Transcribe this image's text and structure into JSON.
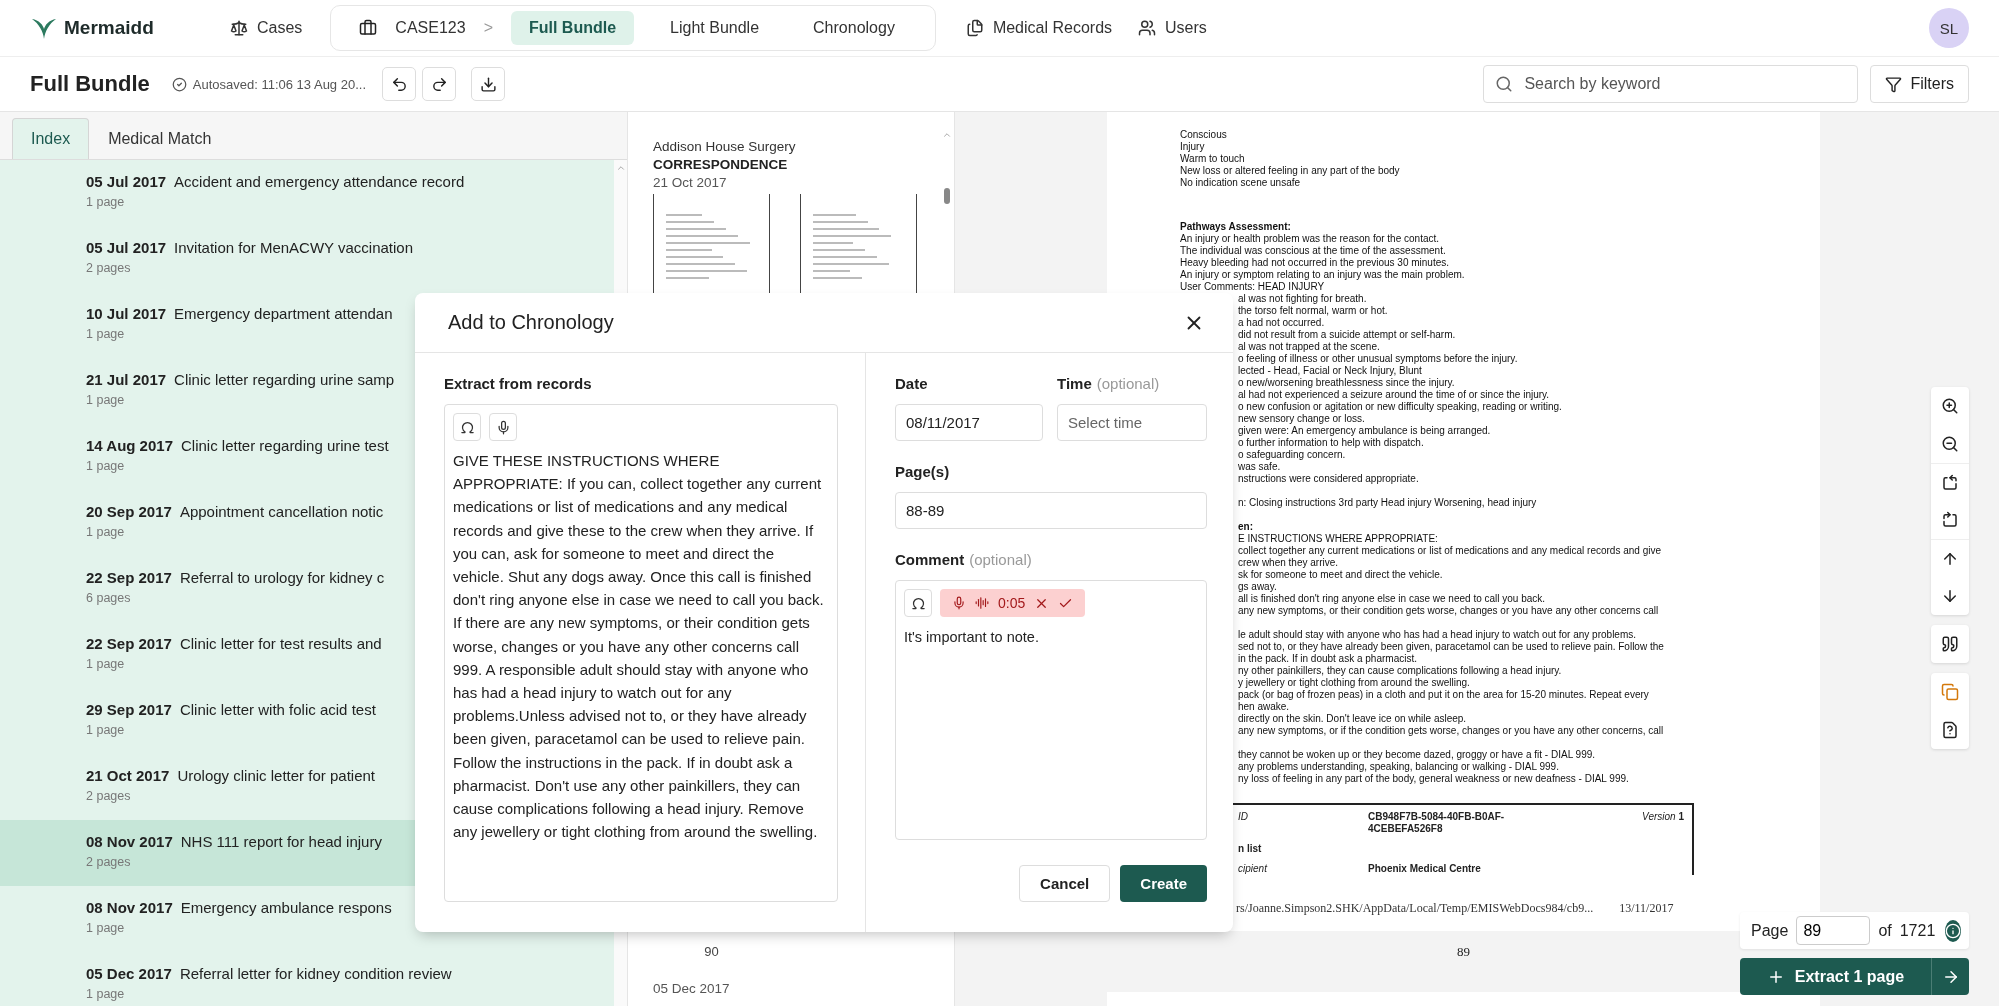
{
  "top_nav": {
    "logo": "Mermaidd",
    "cases": "Cases",
    "case": "CASE123",
    "separator": ">",
    "tabs": [
      {
        "label": "Full Bundle",
        "selected": true
      },
      {
        "label": "Light Bundle",
        "selected": false
      },
      {
        "label": "Chronology",
        "selected": false
      }
    ],
    "links": [
      "Medical Records",
      "Users"
    ],
    "avatar": "SL"
  },
  "toolbar": {
    "title": "Full Bundle",
    "autosaved": "Autosaved: 11:06 13 Aug 20...",
    "search": {
      "placeholder": "Search by keyword"
    },
    "filters": "Filters"
  },
  "index_panel": {
    "tabs": [
      {
        "label": "Index",
        "selected": true
      },
      {
        "label": "Medical Match",
        "selected": false
      }
    ],
    "entries": [
      {
        "date": "05 Jul 2017",
        "title": "Accident and emergency attendance record",
        "pages": "1 page",
        "selected": false
      },
      {
        "date": "05 Jul 2017",
        "title": "Invitation for MenACWY vaccination",
        "pages": "2 pages",
        "selected": false
      },
      {
        "date": "10 Jul 2017",
        "title": "Emergency department attendan",
        "pages": "1 page",
        "selected": false
      },
      {
        "date": "21 Jul 2017",
        "title": "Clinic letter regarding urine samp",
        "pages": "1 page",
        "selected": false
      },
      {
        "date": "14 Aug 2017",
        "title": "Clinic letter regarding urine test",
        "pages": "1 page",
        "selected": false
      },
      {
        "date": "20 Sep 2017",
        "title": "Appointment cancellation notic",
        "pages": "1 page",
        "selected": false
      },
      {
        "date": "22 Sep 2017",
        "title": "Referral to urology for kidney c",
        "pages": "6 pages",
        "selected": false
      },
      {
        "date": "22 Sep 2017",
        "title": "Clinic letter for test results and",
        "pages": "1 page",
        "selected": false
      },
      {
        "date": "29 Sep 2017",
        "title": "Clinic letter with folic acid test",
        "pages": "1 page",
        "selected": false
      },
      {
        "date": "21 Oct 2017",
        "title": "Urology clinic letter for patient",
        "pages": "2 pages",
        "selected": false
      },
      {
        "date": "08 Nov 2017",
        "title": "NHS 111 report for head injury",
        "pages": "2 pages",
        "selected": true
      },
      {
        "date": "08 Nov 2017",
        "title": "Emergency ambulance respons",
        "pages": "1 page",
        "selected": false
      },
      {
        "date": "05 Dec 2017",
        "title": "Referral letter for kidney condition review",
        "pages": "1 page",
        "selected": false
      }
    ]
  },
  "thumbnails": {
    "source": "Addison House Surgery",
    "category": "CORRESPONDENCE",
    "date": "21 Oct 2017",
    "page_number": "90",
    "next_date": "05 Dec 2017"
  },
  "document": {
    "blocks": [
      {
        "lines": [
          {
            "text": "Conscious",
            "kind": "text",
            "cut": false
          },
          {
            "text": "Injury",
            "kind": "text",
            "cut": false
          },
          {
            "text": "Warm to touch",
            "kind": "text",
            "cut": false
          },
          {
            "text": "New loss or altered feeling in any part of the body",
            "kind": "text",
            "cut": false
          },
          {
            "text": "No indication scene unsafe",
            "kind": "text",
            "cut": false
          }
        ]
      },
      {
        "lines": [
          {
            "text": "Pathways Assessment:",
            "kind": "heading",
            "cut": false
          },
          {
            "text": "An injury or health problem was the reason for the contact.",
            "kind": "text",
            "cut": false
          },
          {
            "text": "The individual was conscious at the time of the assessment.",
            "kind": "text",
            "cut": false
          },
          {
            "text": "Heavy bleeding had not occurred in the previous 30 minutes.",
            "kind": "text",
            "cut": false
          },
          {
            "text": "An injury or symptom relating to an injury was the main problem.",
            "kind": "text",
            "cut": false
          },
          {
            "text": "User Comments: HEAD INJURY",
            "kind": "text",
            "cut": false
          },
          {
            "text": "al was not fighting for breath.",
            "kind": "text",
            "cut": true
          },
          {
            "text": "the torso felt normal, warm or hot.",
            "kind": "text",
            "cut": true
          },
          {
            "text": "a had not occurred.",
            "kind": "text",
            "cut": true
          },
          {
            "text": "did not result from a suicide attempt or self-harm.",
            "kind": "text",
            "cut": true
          },
          {
            "text": "al was not trapped at the scene.",
            "kind": "text",
            "cut": true
          },
          {
            "text": "o feeling of illness or other unusual symptoms before the injury.",
            "kind": "text",
            "cut": true
          },
          {
            "text": "lected - Head, Facial or Neck Injury, Blunt",
            "kind": "text",
            "cut": true
          },
          {
            "text": "o new/worsening breathlessness since the injury.",
            "kind": "text",
            "cut": true
          },
          {
            "text": "al had not experienced a seizure around the time of or since the injury.",
            "kind": "text",
            "cut": true
          },
          {
            "text": "o new confusion or agitation or new difficulty speaking, reading or writing.",
            "kind": "text",
            "cut": true
          },
          {
            "text": "new sensory change or loss.",
            "kind": "text",
            "cut": true
          },
          {
            "text": "given were: An emergency ambulance is being arranged.",
            "kind": "text",
            "cut": true
          },
          {
            "text": "o further information to help with dispatch.",
            "kind": "text",
            "cut": true
          },
          {
            "text": "o safeguarding concern.",
            "kind": "text",
            "cut": true
          },
          {
            "text": "was safe.",
            "kind": "text",
            "cut": true
          },
          {
            "text": "nstructions were considered appropriate.",
            "kind": "text",
            "cut": true
          }
        ]
      },
      {
        "lines": [
          {
            "text": "n: Closing instructions 3rd party Head injury Worsening, head injury",
            "kind": "text",
            "cut": true
          }
        ]
      },
      {
        "lines": [
          {
            "text": "en:",
            "kind": "heading",
            "cut": true
          },
          {
            "text": "E INSTRUCTIONS WHERE APPROPRIATE:",
            "kind": "text",
            "cut": true
          },
          {
            "text": "collect together any current medications or list of medications and any medical records and give",
            "kind": "text",
            "cut": true
          },
          {
            "text": "crew when they arrive.",
            "kind": "text",
            "cut": true
          },
          {
            "text": "sk for someone to meet and direct the vehicle.",
            "kind": "text",
            "cut": true
          },
          {
            "text": "gs away.",
            "kind": "text",
            "cut": true
          },
          {
            "text": "all is finished don't ring anyone else in case we need to call you back.",
            "kind": "text",
            "cut": true
          },
          {
            "text": "any new symptoms, or their condition gets worse, changes or you have any other concerns call",
            "kind": "text",
            "cut": true
          }
        ]
      },
      {
        "lines": [
          {
            "text": "le adult should stay with anyone who has had a head injury to watch out for any problems.",
            "kind": "text",
            "cut": true
          },
          {
            "text": "sed not to, or they have already been given, paracetamol can be used to relieve pain. Follow the",
            "kind": "text",
            "cut": true
          },
          {
            "text": "in the pack. If in doubt ask a pharmacist.",
            "kind": "text",
            "cut": true
          },
          {
            "text": "ny other painkillers, they can cause complications following a head injury.",
            "kind": "text",
            "cut": true
          },
          {
            "text": "y jewellery or tight clothing from around the swelling.",
            "kind": "text",
            "cut": true
          },
          {
            "text": "pack (or bag of frozen peas) in a cloth and put it on the area for 15-20 minutes. Repeat every",
            "kind": "text",
            "cut": true
          },
          {
            "text": "hen awake.",
            "kind": "text",
            "cut": true
          },
          {
            "text": "directly on the skin. Don't leave ice on while asleep.",
            "kind": "text",
            "cut": true
          },
          {
            "text": "any new symptoms, or if the condition gets worse, changes or you have any other concerns, call",
            "kind": "text",
            "cut": true
          }
        ]
      },
      {
        "lines": [
          {
            "text": "they cannot be woken up or they become dazed, groggy or have a fit - DIAL 999.",
            "kind": "text",
            "cut": true
          },
          {
            "text": "any problems understanding, speaking, balancing or walking - DIAL 999.",
            "kind": "text",
            "cut": true
          },
          {
            "text": "ny loss of feeling in any part of the body, general weakness or new deafness - DIAL 999.",
            "kind": "text",
            "cut": true
          }
        ]
      }
    ],
    "table": [
      {
        "kind": "field",
        "label": "ID",
        "value": "CB948F7B-5084-40FB-B0AF-4CEBEFA526F8",
        "extra": "*Version* **1**"
      },
      {
        "kind": "section",
        "label": "n list"
      },
      {
        "kind": "field",
        "label": "cipient",
        "value": "Phoenix Medical Centre"
      }
    ],
    "footer_path": "rs/Joanne.Simpson2.SHK/AppData/Local/Temp/EMISWebDocs984/cb9...",
    "footer_date": "13/11/2017",
    "page_number": "89"
  },
  "viewer_controls": {
    "page_label": "Page",
    "page_value": "89",
    "of": "of",
    "total": "1721",
    "extract": "Extract 1 page"
  },
  "dialog": {
    "title": "Add to Chronology",
    "extract": {
      "label": "Extract from records",
      "text": "GIVE THESE INSTRUCTIONS WHERE APPROPRIATE: If you can, collect together any current medications or list of medications and any medical records and give these to the crew when they arrive. If you can, ask for someone to meet and direct the vehicle. Shut any dogs away. Once this call is finished don't ring anyone else in case we need to call you back. If there are any new symptoms, or their condition gets worse, changes or you have any other concerns call 999. A responsible adult should stay with anyone who has had a head injury to watch out for any problems.Unless advised not to, or they have already been given, paracetamol can be used to relieve pain. Follow the instructions in the pack. If in doubt ask a pharmacist. Don't use any other painkillers, they can cause complications following a head injury. Remove any jewellery or tight clothing from around the swelling."
    },
    "date": {
      "label": "Date",
      "value": "08/11/2017"
    },
    "time": {
      "label": "Time",
      "hint": "(optional)",
      "placeholder": "Select time"
    },
    "pages": {
      "label": "Page(s)",
      "value": "88-89"
    },
    "comment": {
      "label": "Comment",
      "hint": "(optional)",
      "recording_time": "0:05",
      "value": "It's important to note."
    },
    "cancel": "Cancel",
    "create": "Create"
  }
}
